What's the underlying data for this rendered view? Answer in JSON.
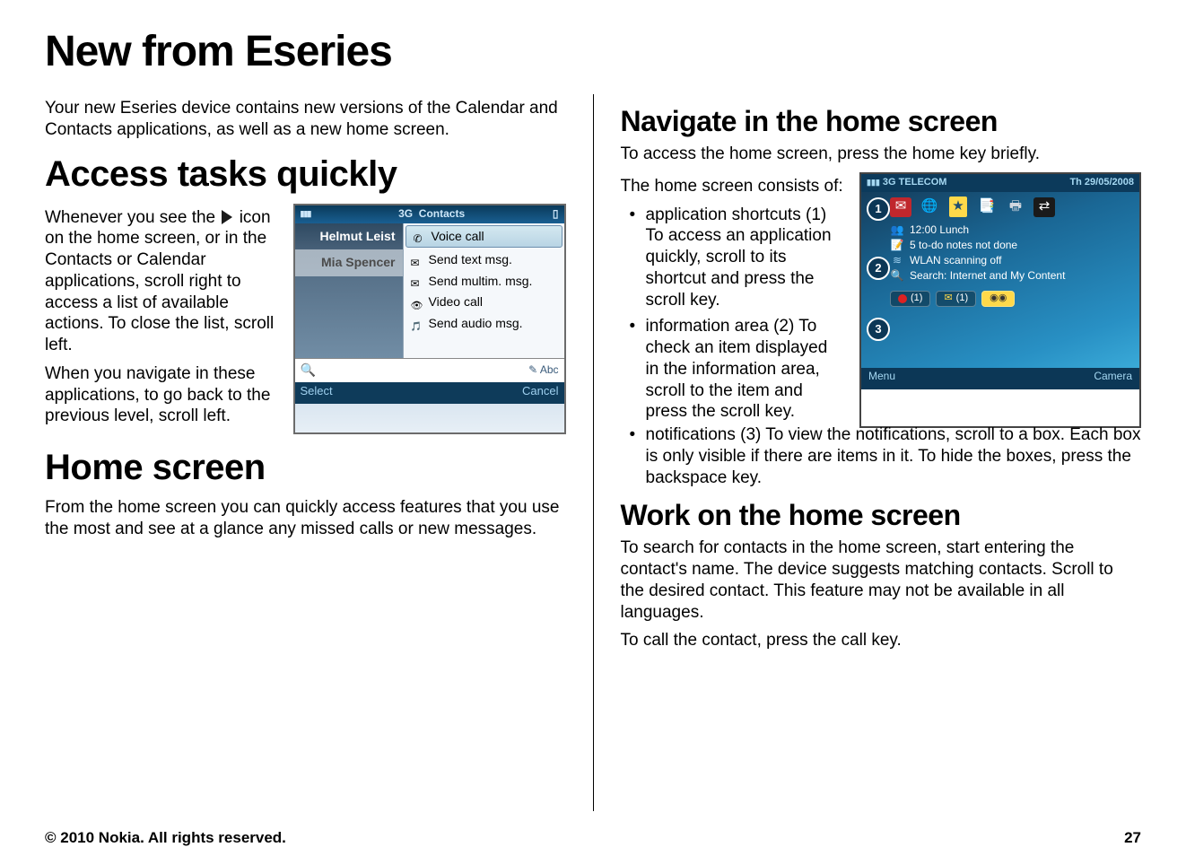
{
  "title": "New from Eseries",
  "intro": "Your new Eseries device contains new versions of the Calendar and Contacts applications, as well as a new home screen.",
  "sections": {
    "access": {
      "heading": "Access tasks quickly",
      "p1a": "Whenever you see the",
      "p1b": "icon on the home screen, or in the Contacts or Calendar applications, scroll right to access a list of available actions. To close the list, scroll left.",
      "p2": "When you navigate in these applications, to go back to the previous level, scroll left."
    },
    "home": {
      "heading": "Home screen",
      "p1": "From the home screen you can quickly access features that you use the most and see at a glance any missed calls or new messages."
    },
    "navigate": {
      "heading": "Navigate in the home screen",
      "lead": "To access the home screen, press the home key briefly.",
      "p_intro": "The home screen consists of:",
      "bullets": [
        "application shortcuts (1) To access an application quickly, scroll to its shortcut and press the scroll key.",
        "information area (2) To check an item displayed in the information area, scroll to the item and press the scroll key.",
        "notifications (3) To view the notifications, scroll to a box. Each box is only visible if there are items in it. To hide the boxes, press the backspace key."
      ]
    },
    "work": {
      "heading": "Work on the home screen",
      "p1": "To search for contacts in the home screen, start entering the contact's name. The device suggests matching contacts. Scroll to the desired contact. This feature may not be available in all languages.",
      "p2": "To call the contact, press the call key."
    }
  },
  "phone1": {
    "status_net": "3G",
    "status_title": "Contacts",
    "contacts": [
      "Helmut Leist",
      "Mia Spencer"
    ],
    "actions": [
      "Voice call",
      "Send text msg.",
      "Send multim. msg.",
      "Video call",
      "Send audio msg."
    ],
    "input_mode": "Abc",
    "softkeys": {
      "left": "Select",
      "right": "Cancel"
    }
  },
  "phone2": {
    "status_net": "3G",
    "status_carrier": "TELECOM",
    "status_date": "Th 29/05/2008",
    "info_rows": [
      "12:00 Lunch",
      "5 to-do notes not done",
      "WLAN scanning off",
      "Search: Internet and My Content"
    ],
    "notif_missed": "(1)",
    "notif_msg": "(1)",
    "softkeys": {
      "left": "Menu",
      "right": "Camera"
    },
    "bubbles": [
      "1",
      "2",
      "3"
    ]
  },
  "footer": {
    "copyright": "© 2010 Nokia. All rights reserved.",
    "page": "27"
  }
}
